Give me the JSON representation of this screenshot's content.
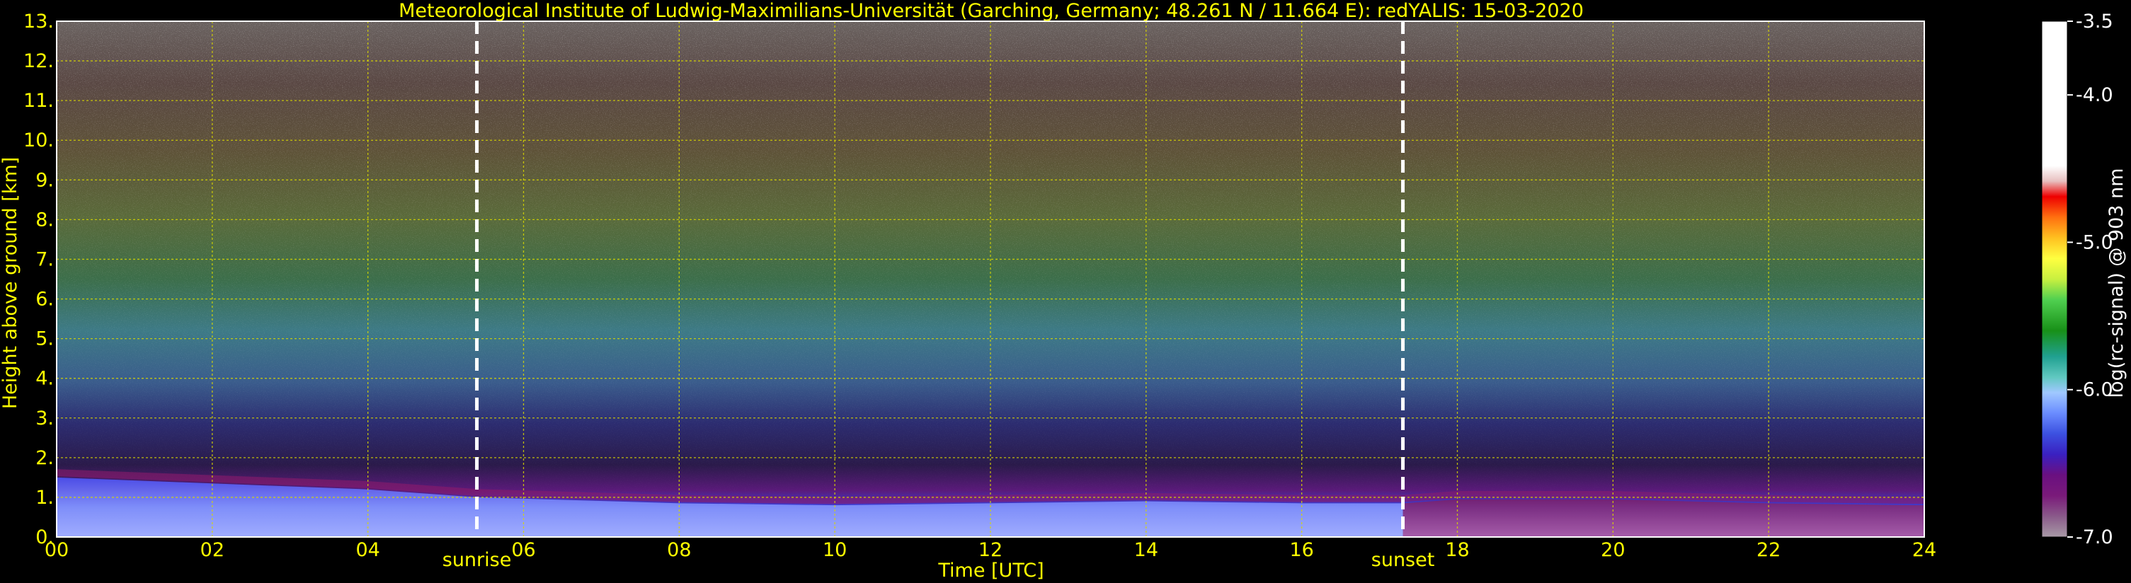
{
  "chart_data": {
    "type": "heatmap",
    "title": "Meteorological Institute of Ludwig-Maximilians-Universität (Garching, Germany; 48.261 N / 11.664 E):    redYALIS: 15-03-2020",
    "xlabel": "Time [UTC]",
    "ylabel": "Height above ground [km]",
    "xlim": [
      0,
      24
    ],
    "ylim": [
      0,
      13
    ],
    "xticks": [
      "00",
      "02",
      "04",
      "06",
      "08",
      "10",
      "12",
      "14",
      "16",
      "18",
      "20",
      "22",
      "24"
    ],
    "yticks": [
      "0.",
      "1.",
      "2.",
      "3.",
      "4.",
      "5.",
      "6.",
      "7.",
      "8.",
      "9.",
      "10.",
      "11.",
      "12.",
      "13."
    ],
    "grid": true,
    "events": [
      {
        "label": "sunrise",
        "x": 5.4
      },
      {
        "label": "sunset",
        "x": 17.3
      }
    ],
    "colorbar": {
      "label": "log(rc-signal) @ 903 nm",
      "range": [
        -7.0,
        -3.5
      ],
      "ticks": [
        "-3.5",
        "-4.0",
        "-5.0",
        "-6.0",
        "-7.0"
      ],
      "tick_values": [
        -3.5,
        -4.0,
        -5.0,
        -6.0,
        -7.0
      ]
    },
    "boundary_layer_top_km": [
      [
        0,
        1.5
      ],
      [
        2,
        1.35
      ],
      [
        4,
        1.2
      ],
      [
        5.4,
        1.0
      ],
      [
        8,
        0.85
      ],
      [
        10,
        0.8
      ],
      [
        12,
        0.85
      ],
      [
        14,
        0.9
      ],
      [
        16,
        0.85
      ],
      [
        17.3,
        0.85
      ],
      [
        18,
        0.95
      ],
      [
        20,
        0.95
      ],
      [
        22,
        0.85
      ],
      [
        24,
        0.8
      ]
    ],
    "colors": {
      "text_accent": "#ffff00",
      "grid": "#d8d800",
      "event_line": "#ffffff",
      "background": "#000000"
    }
  }
}
